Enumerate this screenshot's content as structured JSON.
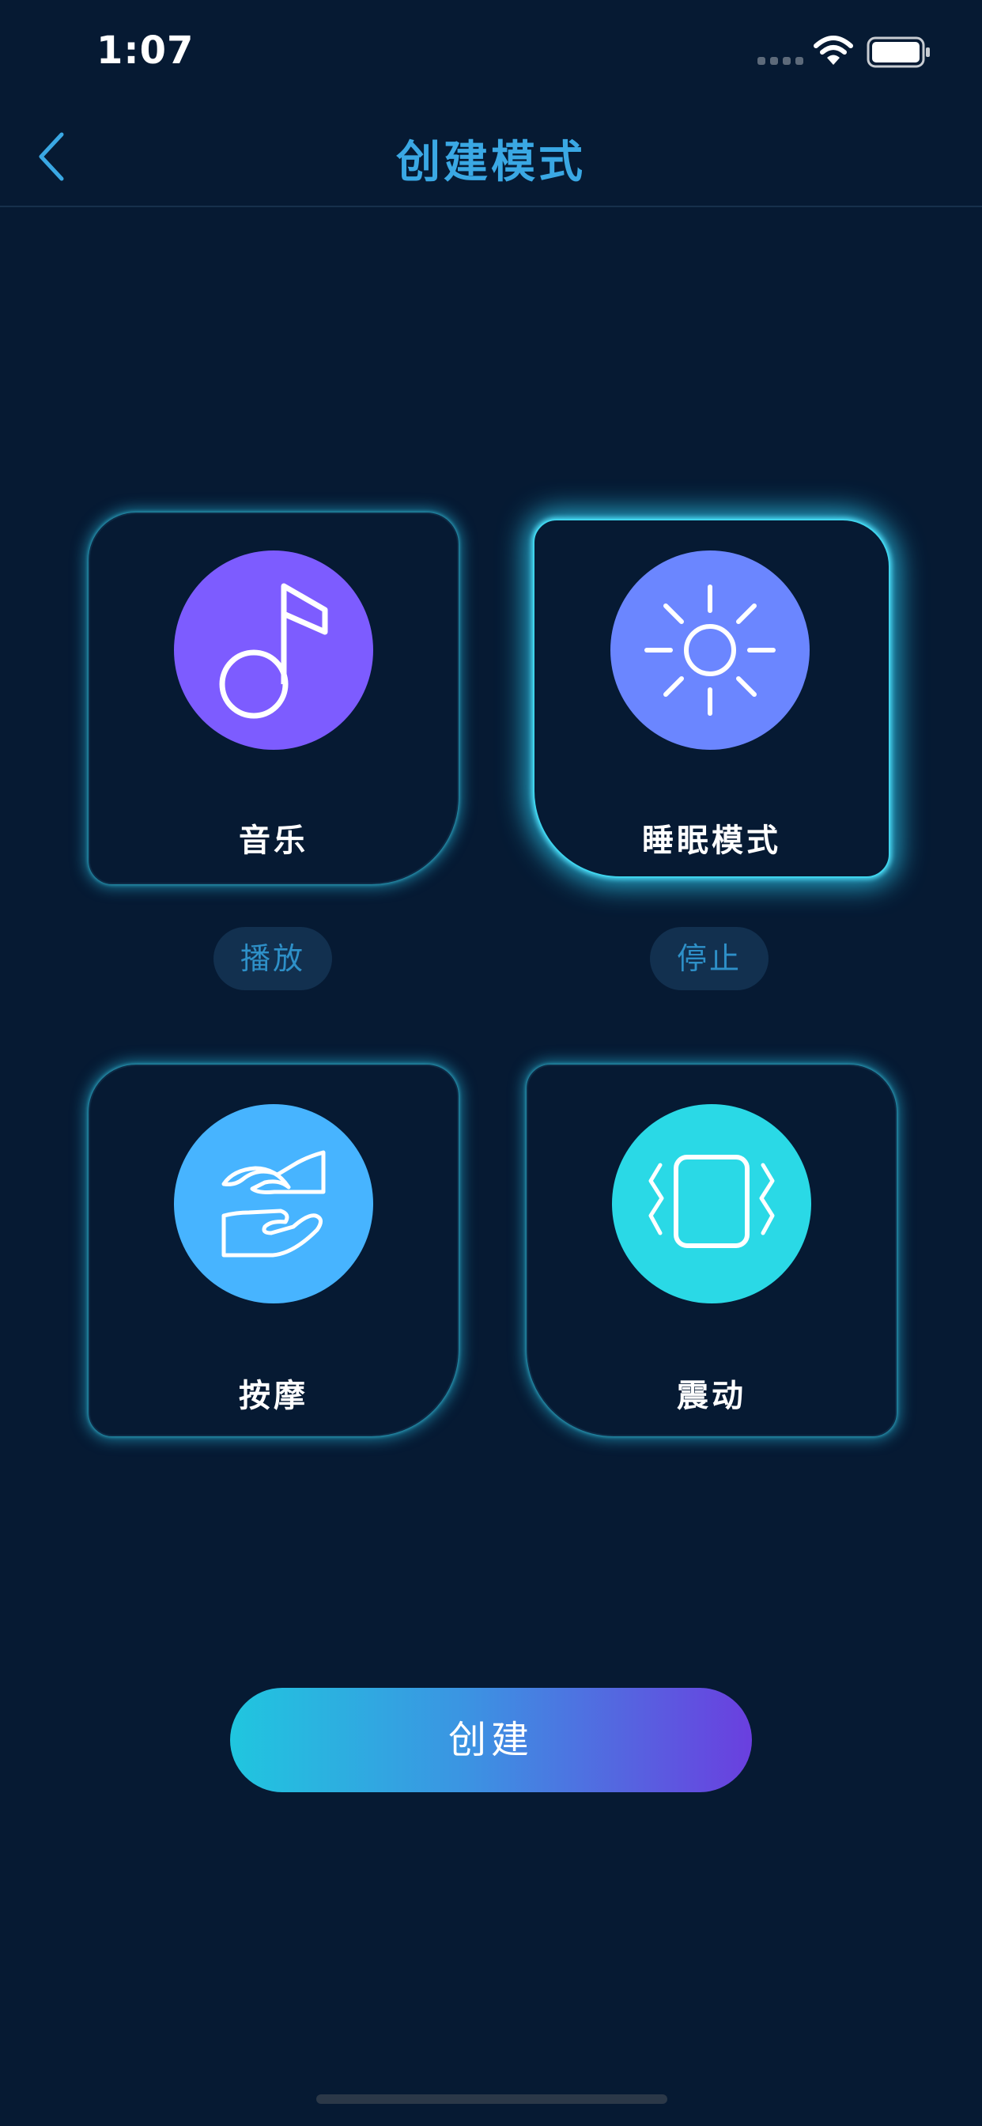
{
  "status_bar": {
    "time": "1:07"
  },
  "nav": {
    "title": "创建模式"
  },
  "cards": [
    {
      "label": "音乐",
      "icon": "music-note-icon",
      "color": "#7d5cff",
      "action": "播放"
    },
    {
      "label": "睡眠模式",
      "icon": "sun-icon",
      "color": "#6b86ff",
      "action": "停止",
      "selected": true
    },
    {
      "label": "按摩",
      "icon": "hands-icon",
      "color": "#47b4ff"
    },
    {
      "label": "震动",
      "icon": "vibration-icon",
      "color": "#2ad9e6"
    }
  ],
  "create_button": {
    "label": "创建"
  },
  "colors": {
    "background": "#061a33",
    "accent": "#3aa8e4",
    "glow": "#2bc4e9"
  }
}
